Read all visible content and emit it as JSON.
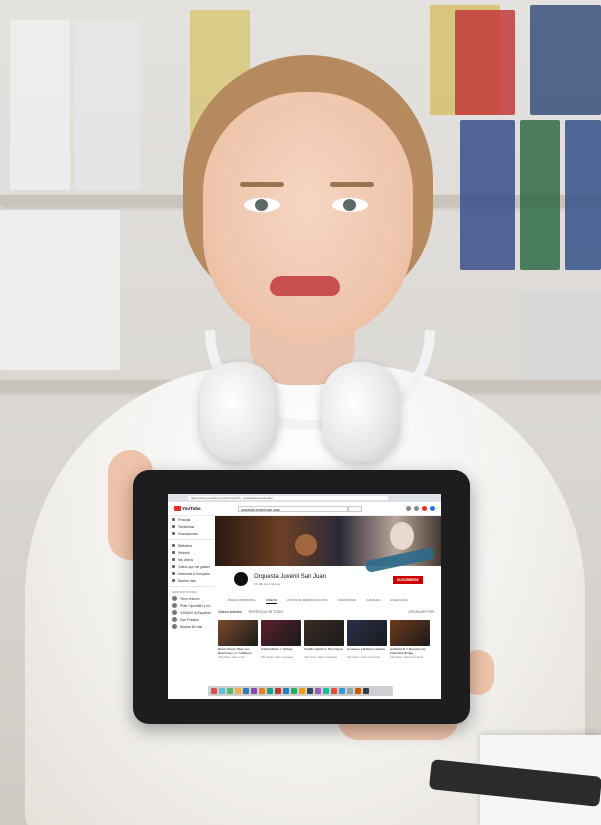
{
  "scene": {
    "description_visible": "",
    "colors": {
      "wall": "#e4e2df",
      "blouse": "#f3f1ee",
      "tablet": "#1d1d1f",
      "youtube_red": "#e52d27"
    }
  },
  "browser": {
    "url": "https://www.youtube.com/channel/UC...orquestajovensanjuan"
  },
  "youtube": {
    "logo": "YouTube",
    "search_value": "orquesta juvenil san juan",
    "sidebar": {
      "items": [
        {
          "icon": "home-icon",
          "label": "Principal"
        },
        {
          "icon": "trending-icon",
          "label": "Tendencias"
        },
        {
          "icon": "subscriptions-icon",
          "label": "Suscripciones"
        }
      ],
      "library": [
        {
          "icon": "library-icon",
          "label": "Biblioteca"
        },
        {
          "icon": "history-icon",
          "label": "Historial"
        },
        {
          "icon": "videos-icon",
          "label": "Mis videos"
        },
        {
          "icon": "watch-later-icon",
          "label": "Videos que me gustan"
        },
        {
          "icon": "playlist-icon",
          "label": "Aventuras & Europeos"
        },
        {
          "icon": "chevron-down-icon",
          "label": "Mostrar más"
        }
      ],
      "subscriptions_heading": "SUSCRIPCIONES",
      "subscriptions": [
        {
          "label": "Tenor resumo"
        },
        {
          "label": "Peter Cipendiño y mi..."
        },
        {
          "label": "JONADO la Española"
        },
        {
          "label": "Vive Practica"
        },
        {
          "label": "Mostrar 60 más"
        }
      ]
    },
    "channel": {
      "name": "Orquesta Juvenil San Juan",
      "subscribers": "15.490 suscriptores",
      "subscribe_label": "SUSCRIBIRSE",
      "tabs": [
        "PÁGINA PRINCIPAL",
        "VIDEOS",
        "LISTAS DE REPRODUCCIÓN",
        "COMUNIDAD",
        "CANALES",
        "ACERCA DE"
      ],
      "active_tab": "VIDEOS",
      "uploads_label": "Videos subidos",
      "play_all_label": "REPRODUCIR TODO",
      "sort_label": "ORDENAR POR"
    },
    "videos": [
      {
        "title": "Bruch Octeto \"Star\" con Beethoven y C. Hallarrdo con...",
        "meta": "730 vistas • hace 1 día",
        "color": "#7a4a2e"
      },
      {
        "title": "Andrés Bravo J. Strings",
        "meta": "322 vistas • hace 1 semana",
        "color": "#5a1f2c"
      },
      {
        "title": "Vivaldo Garcia V. Ship Dance",
        "meta": "245 vistas • hace 2 semanas",
        "color": "#3a2c25"
      },
      {
        "title": "Concierto a Roberto Historia",
        "meta": "192 vistas • hace 2 semanas",
        "color": "#2a2f4a"
      },
      {
        "title": "Audiforia III Y Demarco los Violinistas Bridge",
        "meta": "160 vistas • hace 3 semanas",
        "color": "#6e3a1c"
      }
    ],
    "taskbar_colors": [
      "#d9534f",
      "#5bc0de",
      "#5cb85c",
      "#f0ad4e",
      "#337ab7",
      "#8e44ad",
      "#e67e22",
      "#16a085",
      "#c0392b",
      "#2980b9",
      "#27ae60",
      "#f39c12",
      "#34495e",
      "#9b59b6",
      "#1abc9c",
      "#e74c3c",
      "#3498db",
      "#95a5a6",
      "#d35400",
      "#2c3e50"
    ]
  }
}
